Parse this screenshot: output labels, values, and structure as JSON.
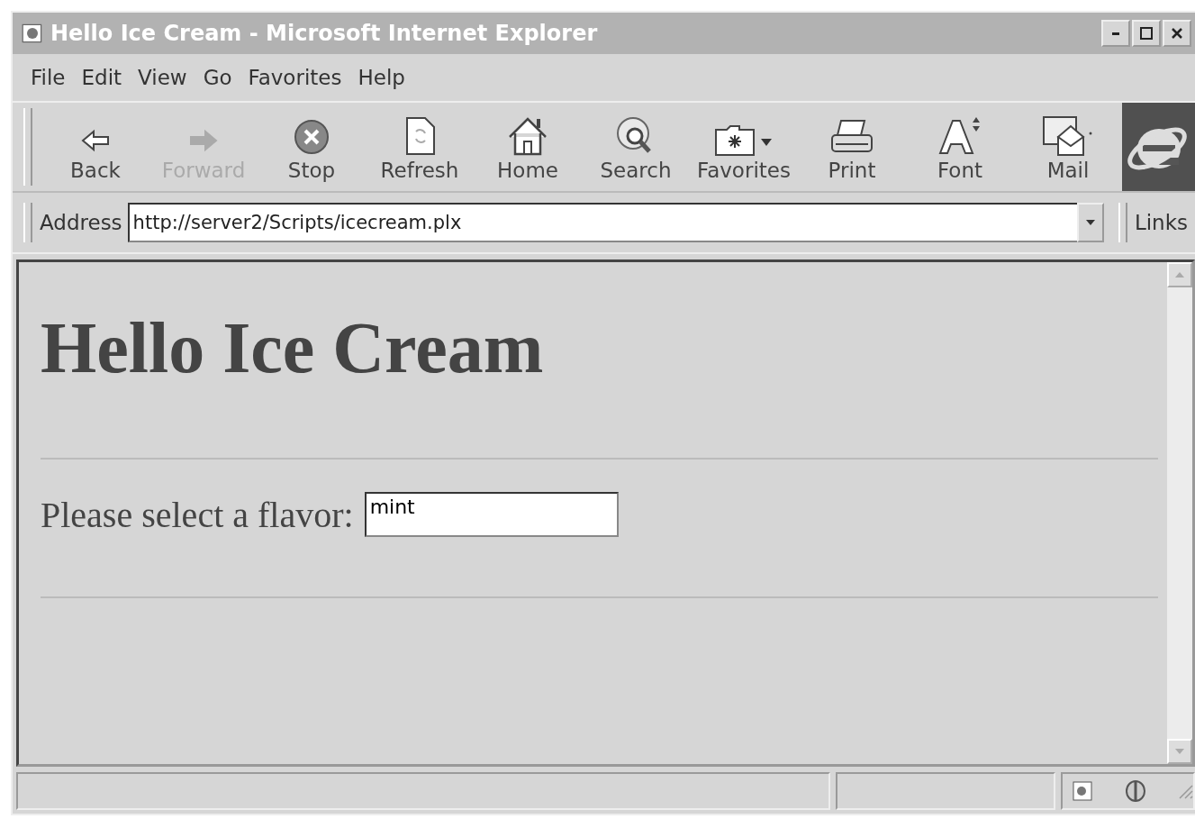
{
  "window": {
    "title": "Hello Ice Cream - Microsoft Internet Explorer"
  },
  "menu": [
    "File",
    "Edit",
    "View",
    "Go",
    "Favorites",
    "Help"
  ],
  "toolbar": [
    {
      "label": "Back",
      "kind": "back",
      "disabled": false
    },
    {
      "label": "Forward",
      "kind": "forward",
      "disabled": true
    },
    {
      "label": "Stop",
      "kind": "stop",
      "disabled": false
    },
    {
      "label": "Refresh",
      "kind": "refresh",
      "disabled": false
    },
    {
      "label": "Home",
      "kind": "home",
      "disabled": false
    },
    {
      "label": "Search",
      "kind": "search",
      "disabled": false
    },
    {
      "label": "Favorites",
      "kind": "favorites",
      "disabled": false
    },
    {
      "label": "Print",
      "kind": "print",
      "disabled": false
    },
    {
      "label": "Font",
      "kind": "font",
      "disabled": false
    },
    {
      "label": "Mail",
      "kind": "mail",
      "disabled": false
    }
  ],
  "address_bar": {
    "label": "Address",
    "value": "http://server2/Scripts/icecream.plx",
    "links": "Links"
  },
  "page": {
    "heading": "Hello Ice Cream",
    "prompt": "Please select a flavor:",
    "flavor_field": {
      "value": "mint"
    }
  }
}
